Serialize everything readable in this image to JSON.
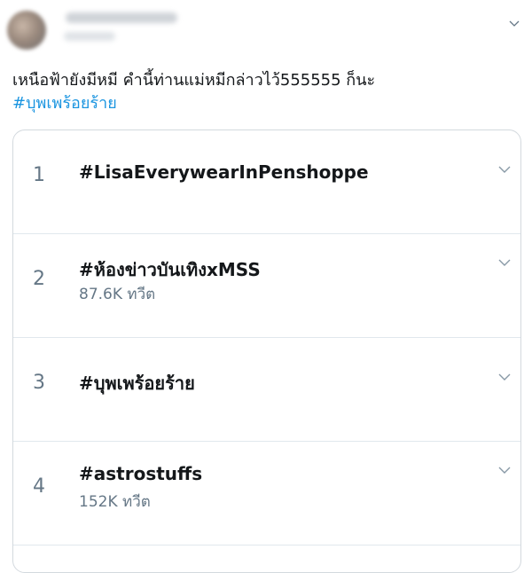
{
  "tweet": {
    "text": "เหนือฟ้ายังมีหมี คำนี้ท่านแม่หมีกล่าวไว้555555  ก็นะ",
    "hashtag": "#บุพเพร้อยร้าย"
  },
  "trends": [
    {
      "rank": "1",
      "name": "#LisaEverywearInPenshoppe",
      "count": ""
    },
    {
      "rank": "2",
      "name": "#ห้องข่าวบันเทิงxMSS",
      "count": "87.6K ทวีต"
    },
    {
      "rank": "3",
      "name": "#บุพเพร้อยร้าย",
      "count": ""
    },
    {
      "rank": "4",
      "name": "#astrostuffs",
      "count": "152K ทวีต"
    }
  ],
  "icons": {
    "menu": "chevron-down-icon",
    "trend_menu": "chevron-down-icon"
  },
  "colors": {
    "link": "#1b95e0",
    "secondary_text": "#657786",
    "border": "#d3d9de"
  }
}
